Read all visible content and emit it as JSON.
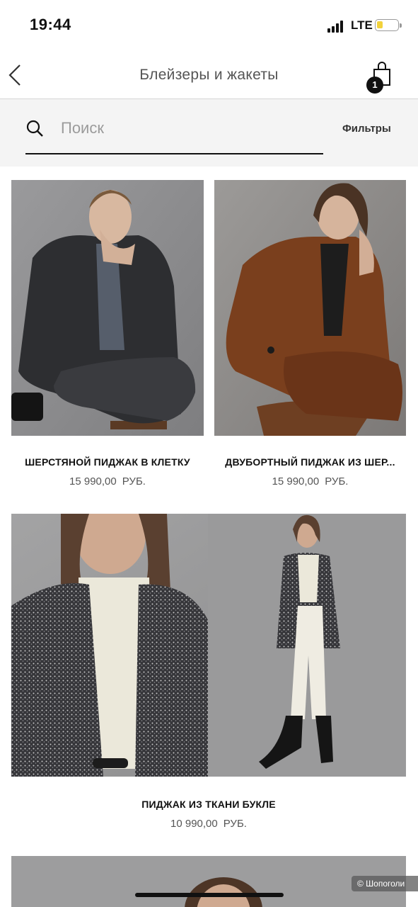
{
  "status_bar": {
    "time": "19:44",
    "network": "LTE",
    "battery_level": 0.3
  },
  "header": {
    "title": "Блейзеры и жакеты",
    "back_icon": "chevron-left-icon",
    "cart_icon": "shopping-bag-icon",
    "cart_count": "1"
  },
  "search": {
    "placeholder": "Поиск",
    "value": "",
    "filters_label": "Фильтры"
  },
  "products": [
    {
      "name": "ШЕРСТЯНОЙ ПИДЖАК В КЛЕТКУ",
      "price": "15 990,00",
      "currency": "РУБ.",
      "image_colors": {
        "background": "#8c8c8e",
        "garment": "#2d2e31"
      }
    },
    {
      "name": "ДВУБОРТНЫЙ ПИДЖАК ИЗ ШЕР...",
      "price": "15 990,00",
      "currency": "РУБ.",
      "image_colors": {
        "background": "#8e8b89",
        "garment": "#7a3f1d"
      }
    },
    {
      "name": "ПИДЖАК ИЗ ТКАНИ БУКЛЕ",
      "price": "10 990,00",
      "currency": "РУБ.",
      "image_colors": {
        "background": "#979798",
        "garment": "#3a3a3e"
      }
    }
  ],
  "watermark": "© Шопоголи"
}
